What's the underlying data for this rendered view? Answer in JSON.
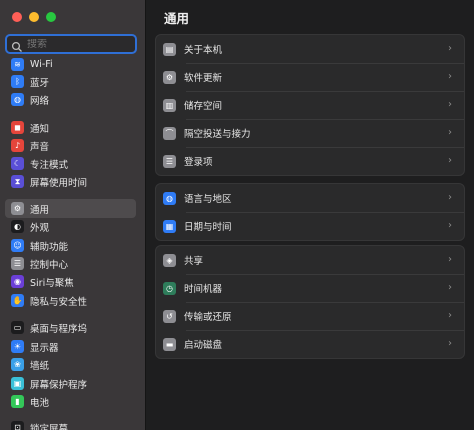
{
  "window": {
    "traffic_lights": {
      "close": "#ff5f57",
      "minimize": "#febc2e",
      "zoom": "#28c840"
    }
  },
  "search": {
    "placeholder": "搜索",
    "icon": "search-icon"
  },
  "sidebar": {
    "items": [
      {
        "label": "Wi-Fi",
        "icon": "wifi-icon",
        "color": "#2f7cf6",
        "glyph": "≋"
      },
      {
        "label": "蓝牙",
        "icon": "bluetooth-icon",
        "color": "#2f7cf6",
        "glyph": "ᛒ"
      },
      {
        "label": "网络",
        "icon": "network-icon",
        "color": "#2f7cf6",
        "glyph": "◍"
      },
      {
        "label": "通知",
        "icon": "notifications-icon",
        "color": "#e5453b",
        "glyph": "◼"
      },
      {
        "label": "声音",
        "icon": "sound-icon",
        "color": "#e5453b",
        "glyph": "♪"
      },
      {
        "label": "专注模式",
        "icon": "focus-icon",
        "color": "#5a4fd6",
        "glyph": "☾"
      },
      {
        "label": "屏幕使用时间",
        "icon": "screen-time-icon",
        "color": "#5a4fd6",
        "glyph": "⧗"
      },
      {
        "label": "通用",
        "icon": "general-gear-icon",
        "color": "#8e8e93",
        "glyph": "⚙"
      },
      {
        "label": "外观",
        "icon": "appearance-icon",
        "color": "#1c1c1e",
        "glyph": "◐"
      },
      {
        "label": "辅助功能",
        "icon": "accessibility-icon",
        "color": "#2f7cf6",
        "glyph": "☺"
      },
      {
        "label": "控制中心",
        "icon": "control-center-icon",
        "color": "#8e8e93",
        "glyph": "☰"
      },
      {
        "label": "Siri与聚焦",
        "icon": "siri-icon",
        "color": "#6b3fd6",
        "glyph": "◉"
      },
      {
        "label": "隐私与安全性",
        "icon": "privacy-hand-icon",
        "color": "#2f7cf6",
        "glyph": "✋"
      },
      {
        "label": "桌面与程序坞",
        "icon": "desktop-dock-icon",
        "color": "#1c1c1e",
        "glyph": "▭"
      },
      {
        "label": "显示器",
        "icon": "display-icon",
        "color": "#2f7cf6",
        "glyph": "☀"
      },
      {
        "label": "墙纸",
        "icon": "wallpaper-icon",
        "color": "#3aa0e8",
        "glyph": "❀"
      },
      {
        "label": "屏幕保护程序",
        "icon": "screensaver-icon",
        "color": "#3ac0d8",
        "glyph": "▣"
      },
      {
        "label": "电池",
        "icon": "battery-icon",
        "color": "#34c759",
        "glyph": "▮"
      },
      {
        "label": "锁定屏幕",
        "icon": "lock-screen-icon",
        "color": "#1c1c1e",
        "glyph": "⊡"
      }
    ],
    "selected": "通用"
  },
  "main": {
    "title": "通用",
    "groups": [
      {
        "rows": [
          {
            "label": "关于本机",
            "icon": "about-icon",
            "color": "#8e8e93",
            "glyph": "▤"
          },
          {
            "label": "软件更新",
            "icon": "software-update-icon",
            "color": "#8e8e93",
            "glyph": "⚙"
          },
          {
            "label": "储存空间",
            "icon": "storage-icon",
            "color": "#8e8e93",
            "glyph": "▥"
          },
          {
            "label": "隔空投送与接力",
            "icon": "airdrop-icon",
            "color": "#8e8e93",
            "glyph": "⌒"
          },
          {
            "label": "登录项",
            "icon": "login-items-icon",
            "color": "#8e8e93",
            "glyph": "☰"
          }
        ]
      },
      {
        "rows": [
          {
            "label": "语言与地区",
            "icon": "language-globe-icon",
            "color": "#2f7cf6",
            "glyph": "◍"
          },
          {
            "label": "日期与时间",
            "icon": "date-time-icon",
            "color": "#2f7cf6",
            "glyph": "▦"
          }
        ]
      },
      {
        "rows": [
          {
            "label": "共享",
            "icon": "sharing-icon",
            "color": "#8e8e93",
            "glyph": "◈"
          },
          {
            "label": "时间机器",
            "icon": "time-machine-icon",
            "color": "#2e7d5b",
            "glyph": "◷"
          },
          {
            "label": "传输或还原",
            "icon": "transfer-reset-icon",
            "color": "#8e8e93",
            "glyph": "↺"
          },
          {
            "label": "启动磁盘",
            "icon": "startup-disk-icon",
            "color": "#8e8e93",
            "glyph": "▬"
          }
        ]
      }
    ],
    "chevron": "›"
  }
}
